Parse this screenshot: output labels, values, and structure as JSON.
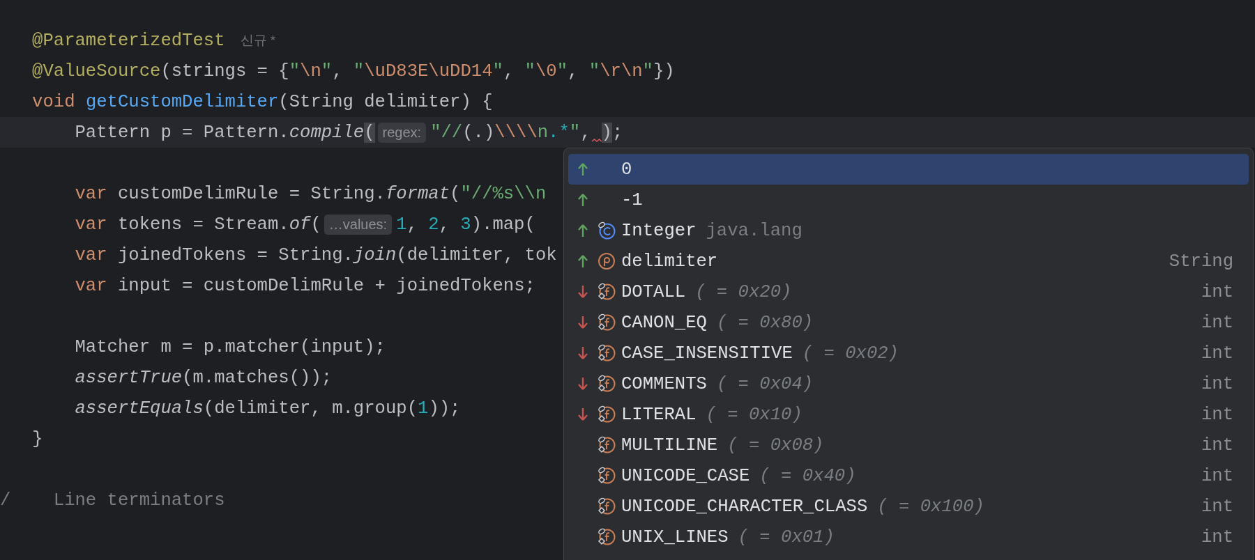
{
  "editor": {
    "lines": [
      {
        "current": false,
        "parts": [
          {
            "kind": "code",
            "tokens": [
              {
                "t": "   @ParameterizedTest",
                "kind": "ann"
              }
            ]
          },
          {
            "kind": "author",
            "text": "신규 *"
          }
        ]
      },
      {
        "current": false,
        "parts": [
          {
            "kind": "code",
            "tokens": [
              {
                "t": "   @ValueSource",
                "kind": "ann"
              },
              {
                "t": "(strings = {",
                "kind": "plain"
              },
              {
                "t": "\"",
                "kind": "str"
              },
              {
                "t": "\\n",
                "kind": "esc"
              },
              {
                "t": "\"",
                "kind": "str"
              },
              {
                "t": ", ",
                "kind": "plain"
              },
              {
                "t": "\"",
                "kind": "str"
              },
              {
                "t": "\\uD83E\\uDD14",
                "kind": "esc"
              },
              {
                "t": "\"",
                "kind": "str"
              },
              {
                "t": ", ",
                "kind": "plain"
              },
              {
                "t": "\"",
                "kind": "str"
              },
              {
                "t": "\\0",
                "kind": "esc"
              },
              {
                "t": "\"",
                "kind": "str"
              },
              {
                "t": ", ",
                "kind": "plain"
              },
              {
                "t": "\"",
                "kind": "str"
              },
              {
                "t": "\\r\\n",
                "kind": "esc"
              },
              {
                "t": "\"",
                "kind": "str"
              },
              {
                "t": "})",
                "kind": "plain"
              }
            ]
          }
        ]
      },
      {
        "current": false,
        "parts": [
          {
            "kind": "code",
            "tokens": [
              {
                "t": "   void ",
                "kind": "kw"
              },
              {
                "t": "getCustomDelimiter",
                "kind": "fn"
              },
              {
                "t": "(String delimiter) {",
                "kind": "plain"
              }
            ]
          }
        ]
      },
      {
        "current": true,
        "parts": [
          {
            "kind": "code",
            "tokens": [
              {
                "t": "       Pattern p = Pattern.",
                "kind": "plain"
              },
              {
                "t": "compile",
                "kind": "it"
              },
              {
                "t": "(",
                "kind": "brace"
              }
            ]
          },
          {
            "kind": "hint",
            "text": "regex:"
          },
          {
            "kind": "code",
            "tokens": [
              {
                "t": "\"//",
                "kind": "str"
              },
              {
                "t": "(.)",
                "kind": "plain"
              },
              {
                "t": "\\\\\\\\",
                "kind": "esc"
              },
              {
                "t": "n",
                "kind": "str"
              },
              {
                "t": ".*",
                "kind": "re"
              },
              {
                "t": "\"",
                "kind": "str"
              },
              {
                "t": ",",
                "kind": "plain"
              }
            ]
          },
          {
            "kind": "squiggle"
          },
          {
            "kind": "code",
            "tokens": [
              {
                "t": ")",
                "kind": "brace"
              },
              {
                "t": ";",
                "kind": "plain"
              }
            ]
          }
        ]
      },
      {
        "current": false
      },
      {
        "current": false,
        "parts": [
          {
            "kind": "code",
            "tokens": [
              {
                "t": "       var",
                "kind": "kw"
              },
              {
                "t": " customDelimRule = String.",
                "kind": "plain"
              },
              {
                "t": "format",
                "kind": "it"
              },
              {
                "t": "(",
                "kind": "plain"
              },
              {
                "t": "\"//%s\\\\n",
                "kind": "str"
              }
            ]
          }
        ]
      },
      {
        "current": false,
        "parts": [
          {
            "kind": "code",
            "tokens": [
              {
                "t": "       var",
                "kind": "kw"
              },
              {
                "t": " tokens = Stream.",
                "kind": "plain"
              },
              {
                "t": "of",
                "kind": "it"
              },
              {
                "t": "(",
                "kind": "plain"
              }
            ]
          },
          {
            "kind": "hint",
            "text": "…values:"
          },
          {
            "kind": "code",
            "tokens": [
              {
                "t": "1",
                "kind": "num"
              },
              {
                "t": ", ",
                "kind": "plain"
              },
              {
                "t": "2",
                "kind": "num"
              },
              {
                "t": ", ",
                "kind": "plain"
              },
              {
                "t": "3",
                "kind": "num"
              },
              {
                "t": ").map(",
                "kind": "plain"
              }
            ]
          }
        ]
      },
      {
        "current": false,
        "parts": [
          {
            "kind": "code",
            "tokens": [
              {
                "t": "       var",
                "kind": "kw"
              },
              {
                "t": " joinedTokens = String.",
                "kind": "plain"
              },
              {
                "t": "join",
                "kind": "it"
              },
              {
                "t": "(delimiter, tok",
                "kind": "plain"
              }
            ]
          }
        ]
      },
      {
        "current": false,
        "parts": [
          {
            "kind": "code",
            "tokens": [
              {
                "t": "       var",
                "kind": "kw"
              },
              {
                "t": " input = customDelimRule + joinedTokens;",
                "kind": "plain"
              }
            ]
          }
        ]
      },
      {
        "current": false
      },
      {
        "current": false,
        "parts": [
          {
            "kind": "code",
            "tokens": [
              {
                "t": "       Matcher m = p.matcher(input);",
                "kind": "plain"
              }
            ]
          }
        ]
      },
      {
        "current": false,
        "parts": [
          {
            "kind": "code",
            "tokens": [
              {
                "t": "       assertTrue",
                "kind": "it"
              },
              {
                "t": "(m.matches());",
                "kind": "plain"
              }
            ]
          }
        ]
      },
      {
        "current": false,
        "parts": [
          {
            "kind": "code",
            "tokens": [
              {
                "t": "       assertEquals",
                "kind": "it"
              },
              {
                "t": "(delimiter, m.group(",
                "kind": "plain"
              },
              {
                "t": "1",
                "kind": "num"
              },
              {
                "t": "));",
                "kind": "plain"
              }
            ]
          }
        ]
      },
      {
        "current": false,
        "parts": [
          {
            "kind": "code",
            "tokens": [
              {
                "t": "   }",
                "kind": "plain"
              }
            ]
          }
        ]
      },
      {
        "current": false
      },
      {
        "current": false,
        "parts": [
          {
            "kind": "code",
            "tokens": [
              {
                "t": "/    Line terminators",
                "kind": "comment"
              }
            ]
          }
        ]
      }
    ]
  },
  "completion_popup": {
    "items": [
      {
        "name": "0",
        "promoted": true,
        "kind": "value",
        "selected": true
      },
      {
        "name": "-1",
        "promoted": true,
        "kind": "value",
        "selected": false
      },
      {
        "name": "Integer",
        "detail": "java.lang",
        "promoted": true,
        "kind": "class",
        "selected": false
      },
      {
        "name": "delimiter",
        "type": "String",
        "promoted": true,
        "kind": "parameter",
        "selected": false
      },
      {
        "name": "DOTALL",
        "detail": "( = 0x20)",
        "type": "int",
        "promoted": false,
        "demoted": true,
        "kind": "field",
        "selected": false
      },
      {
        "name": "CANON_EQ",
        "detail": "( = 0x80)",
        "type": "int",
        "promoted": false,
        "demoted": true,
        "kind": "field",
        "selected": false
      },
      {
        "name": "CASE_INSENSITIVE",
        "detail": "( = 0x02)",
        "type": "int",
        "promoted": false,
        "demoted": true,
        "kind": "field",
        "selected": false
      },
      {
        "name": "COMMENTS",
        "detail": "( = 0x04)",
        "type": "int",
        "promoted": false,
        "demoted": true,
        "kind": "field",
        "selected": false
      },
      {
        "name": "LITERAL",
        "detail": "( = 0x10)",
        "type": "int",
        "promoted": false,
        "demoted": true,
        "kind": "field",
        "selected": false
      },
      {
        "name": "MULTILINE",
        "detail": "( = 0x08)",
        "type": "int",
        "promoted": false,
        "demoted": false,
        "kind": "field",
        "selected": false
      },
      {
        "name": "UNICODE_CASE",
        "detail": "( = 0x40)",
        "type": "int",
        "promoted": false,
        "demoted": false,
        "kind": "field",
        "selected": false
      },
      {
        "name": "UNICODE_CHARACTER_CLASS",
        "detail": "( = 0x100)",
        "type": "int",
        "promoted": false,
        "demoted": false,
        "kind": "field",
        "selected": false
      },
      {
        "name": "UNIX_LINES",
        "detail": "( = 0x01)",
        "type": "int",
        "promoted": false,
        "demoted": false,
        "kind": "field",
        "selected": false
      }
    ]
  }
}
